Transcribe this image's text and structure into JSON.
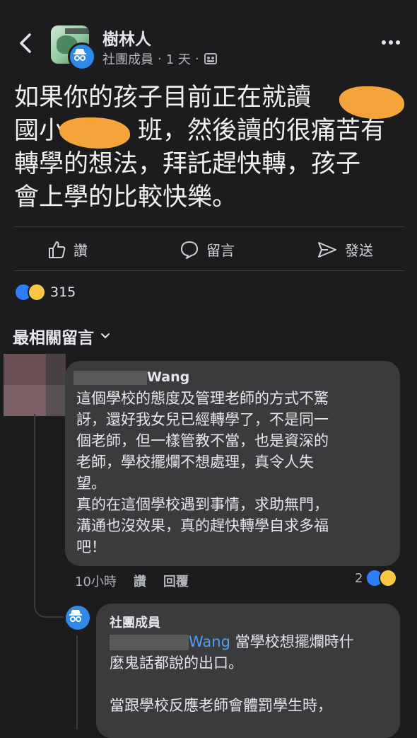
{
  "header": {
    "group_name": "樹林人",
    "author_role": "社團成員",
    "time": "1 天",
    "separator": "·"
  },
  "post": {
    "lines": [
      "如果你的孩子目前正在就讀",
      "國小　　　班，然後讀的很痛苦有",
      "轉學的想法，拜託趕快轉，孩子",
      "會上學的比較快樂。"
    ]
  },
  "actions": {
    "like": "讚",
    "comment": "留言",
    "share": "發送"
  },
  "reactions": {
    "count": "315"
  },
  "comments_sort": "最相關留言",
  "comment1": {
    "name_suffix": "Wang",
    "lines": [
      "這個學校的態度及管理老師的方式不驚",
      "訝，還好我女兒已經轉學了，不是同一",
      "個老師，但一樣管教不當，也是資深的",
      "老師，學校擺爛不想處理，真令人失",
      "望。",
      "真的在這個學校遇到事情，求助無門，",
      "溝通也沒效果，真的趕快轉學自求多福",
      "吧！"
    ],
    "time": "10小時",
    "like": "讚",
    "reply": "回覆",
    "reaction_count": "2"
  },
  "comment2": {
    "name": "社團成員",
    "mention": "Wang",
    "line1_rest": " 當學校想擺爛時什",
    "lines": [
      "麼鬼話都說的出口。",
      "",
      "當跟學校反應老師會體罰學生時，"
    ]
  }
}
